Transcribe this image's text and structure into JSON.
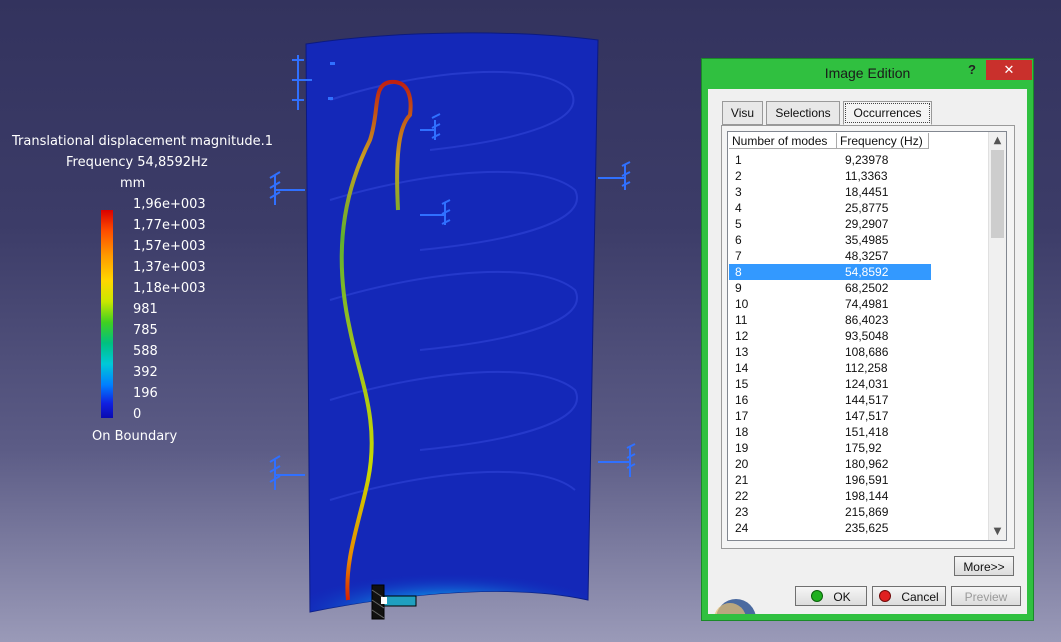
{
  "legend": {
    "title": "Translational displacement magnitude.1",
    "frequency": "Frequency 54,8592Hz",
    "unit": "mm",
    "ticks": [
      "1,96e+003",
      "1,77e+003",
      "1,57e+003",
      "1,37e+003",
      "1,18e+003",
      "981",
      "785",
      "588",
      "392",
      "196",
      "0"
    ],
    "boundary": "On Boundary"
  },
  "dialog": {
    "title": "Image Edition",
    "help": "?",
    "close": "✕",
    "tabs": [
      "Visu",
      "Selections",
      "Occurrences"
    ],
    "active_tab": "Occurrences",
    "columns": [
      "Number of modes",
      "Frequency (Hz)"
    ],
    "selected_mode": "8",
    "modes": [
      {
        "n": "1",
        "f": "9,23978"
      },
      {
        "n": "2",
        "f": "11,3363"
      },
      {
        "n": "3",
        "f": "18,4451"
      },
      {
        "n": "4",
        "f": "25,8775"
      },
      {
        "n": "5",
        "f": "29,2907"
      },
      {
        "n": "6",
        "f": "35,4985"
      },
      {
        "n": "7",
        "f": "48,3257"
      },
      {
        "n": "8",
        "f": "54,8592"
      },
      {
        "n": "9",
        "f": "68,2502"
      },
      {
        "n": "10",
        "f": "74,4981"
      },
      {
        "n": "11",
        "f": "86,4023"
      },
      {
        "n": "12",
        "f": "93,5048"
      },
      {
        "n": "13",
        "f": "108,686"
      },
      {
        "n": "14",
        "f": "112,258"
      },
      {
        "n": "15",
        "f": "124,031"
      },
      {
        "n": "16",
        "f": "144,517"
      },
      {
        "n": "17",
        "f": "147,517"
      },
      {
        "n": "18",
        "f": "151,418"
      },
      {
        "n": "19",
        "f": "175,92"
      },
      {
        "n": "20",
        "f": "180,962"
      },
      {
        "n": "21",
        "f": "196,591"
      },
      {
        "n": "22",
        "f": "198,144"
      },
      {
        "n": "23",
        "f": "215,869"
      },
      {
        "n": "24",
        "f": "235,625"
      }
    ],
    "more_label": "More>>",
    "ok_label": "OK",
    "cancel_label": "Cancel",
    "preview_label": "Preview"
  },
  "colors": {
    "dialog_frame": "#30c040",
    "selection": "#3399ff",
    "model_blue": "#1020b8"
  },
  "icons": {
    "help": "help-icon",
    "close": "close-icon",
    "ok": "green-dot-icon",
    "cancel": "red-dot-icon",
    "scroll_up": "chevron-up-icon",
    "scroll_down": "chevron-down-icon"
  }
}
